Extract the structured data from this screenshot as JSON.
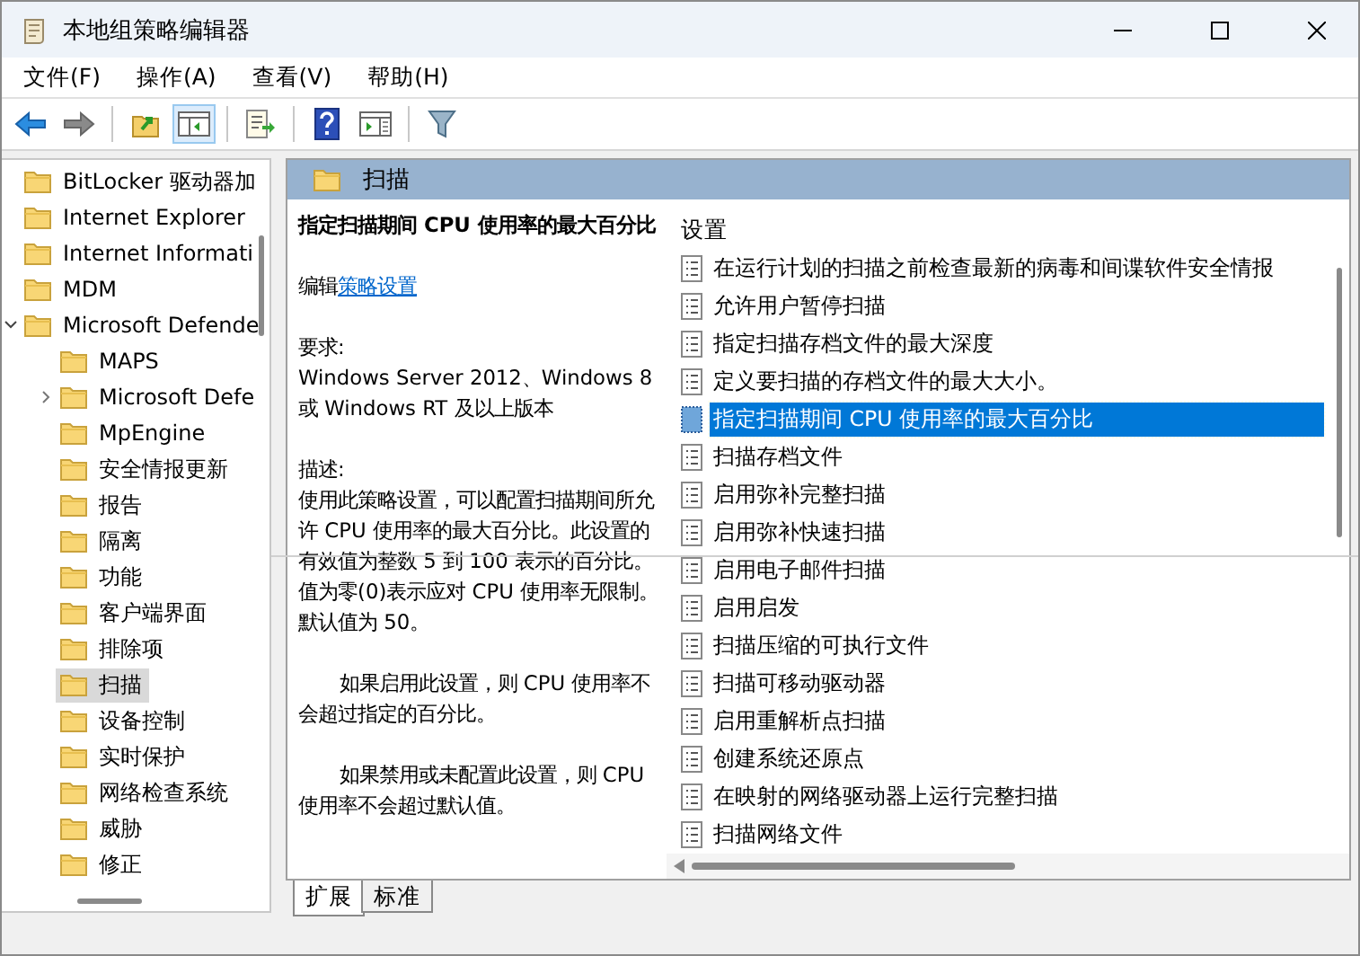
{
  "window": {
    "title": "本地组策略编辑器"
  },
  "menu": [
    "文件(F)",
    "操作(A)",
    "查看(V)",
    "帮助(H)"
  ],
  "toolbar": [
    {
      "kind": "back",
      "pressed": false
    },
    {
      "kind": "forward",
      "pressed": false
    },
    {
      "kind": "sep"
    },
    {
      "kind": "up",
      "pressed": false
    },
    {
      "kind": "tree",
      "pressed": true
    },
    {
      "kind": "sep"
    },
    {
      "kind": "export",
      "pressed": false
    },
    {
      "kind": "sep"
    },
    {
      "kind": "help",
      "pressed": false
    },
    {
      "kind": "pane",
      "pressed": false
    },
    {
      "kind": "sep"
    },
    {
      "kind": "filter",
      "pressed": false
    }
  ],
  "tree": [
    {
      "label": "BitLocker 驱动器加",
      "selected": false
    },
    {
      "label": "Internet Explorer",
      "selected": false
    },
    {
      "label": "Internet Informati",
      "selected": false
    },
    {
      "label": "MDM",
      "selected": false
    },
    {
      "label": "Microsoft Defende",
      "selected": false,
      "expanded": true,
      "children": [
        {
          "label": "MAPS",
          "selected": false
        },
        {
          "label": "Microsoft Defe",
          "selected": false,
          "expanded": false
        },
        {
          "label": "MpEngine",
          "selected": false
        },
        {
          "label": "安全情报更新",
          "selected": false
        },
        {
          "label": "报告",
          "selected": false
        },
        {
          "label": "隔离",
          "selected": false
        },
        {
          "label": "功能",
          "selected": false
        },
        {
          "label": "客户端界面",
          "selected": false
        },
        {
          "label": "排除项",
          "selected": false
        },
        {
          "label": "扫描",
          "selected": true
        },
        {
          "label": "设备控制",
          "selected": false
        },
        {
          "label": "实时保护",
          "selected": false
        },
        {
          "label": "网络检查系统",
          "selected": false
        },
        {
          "label": "威胁",
          "selected": false
        },
        {
          "label": "修正",
          "selected": false
        }
      ]
    }
  ],
  "header": {
    "title": "扫描"
  },
  "description": {
    "title": "指定扫描期间 CPU 使用率的最大百分比",
    "edit_prefix": "编辑",
    "edit_link": "策略设置",
    "requirements_label": "要求:",
    "requirements": "Windows Server 2012、Windows 8 或 Windows RT 及以上版本",
    "description_label": "描述:",
    "paragraphs": [
      {
        "text": "使用此策略设置，可以配置扫描期间所允许 CPU 使用率的最大百分比。此设置的有效值为整数 5 到 100 表示的百分比。值为零(0)表示应对 CPU 使用率无限制。默认值为 50。",
        "indented": false
      },
      {
        "text": "如果启用此设置，则 CPU 使用率不会超过指定的百分比。",
        "indented": true
      },
      {
        "text": "如果禁用或未配置此设置，则 CPU 使用率不会超过默认值。",
        "indented": true
      }
    ]
  },
  "settings": {
    "column": "设置",
    "rows": [
      {
        "label": "在运行计划的扫描之前检查最新的病毒和间谍软件安全情报",
        "selected": false
      },
      {
        "label": "允许用户暂停扫描",
        "selected": false
      },
      {
        "label": "指定扫描存档文件的最大深度",
        "selected": false
      },
      {
        "label": "定义要扫描的存档文件的最大大小。",
        "selected": false
      },
      {
        "label": "指定扫描期间 CPU 使用率的最大百分比",
        "selected": true
      },
      {
        "label": "扫描存档文件",
        "selected": false
      },
      {
        "label": "启用弥补完整扫描",
        "selected": false
      },
      {
        "label": "启用弥补快速扫描",
        "selected": false
      },
      {
        "label": "启用电子邮件扫描",
        "selected": false
      },
      {
        "label": "启用启发",
        "selected": false
      },
      {
        "label": "扫描压缩的可执行文件",
        "selected": false
      },
      {
        "label": "扫描可移动驱动器",
        "selected": false
      },
      {
        "label": "启用重解析点扫描",
        "selected": false
      },
      {
        "label": "创建系统还原点",
        "selected": false
      },
      {
        "label": "在映射的网络驱动器上运行完整扫描",
        "selected": false
      },
      {
        "label": "扫描网络文件",
        "selected": false
      }
    ]
  },
  "tabs": [
    {
      "label": "扩展",
      "selected": true
    },
    {
      "label": "标准",
      "selected": false
    }
  ]
}
